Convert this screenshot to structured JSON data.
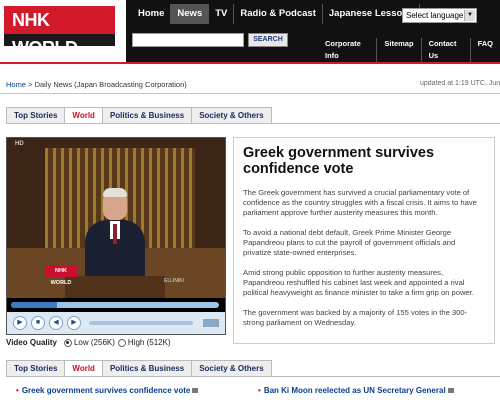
{
  "header": {
    "logo": "NHK WORLD",
    "nav_main": [
      "Home",
      "News",
      "TV",
      "Radio & Podcast",
      "Japanese Lessons"
    ],
    "nav_active": "News",
    "language_select": "Select language",
    "search_placeholder": "",
    "search_button": "SEARCH",
    "nav_sub": [
      "Corporate Info",
      "Sitemap",
      "Contact Us",
      "FAQ"
    ]
  },
  "breadcrumb": {
    "home": "Home",
    "sep": " > ",
    "current": "Daily News (Japan Broadcasting Corporation)"
  },
  "updated": "updated at 1:19 UTC, Jun. 22",
  "tabs": [
    "Top Stories",
    "World",
    "Politics & Business",
    "Society & Others"
  ],
  "tabs_active": "World",
  "video": {
    "hd_label": "HD",
    "watermark": "NHK WORLD",
    "corner_label": "ELLINIKI",
    "progress": 0.22,
    "quality_label": "Video Quality",
    "quality_low": "Low (256K)",
    "quality_high": "High (512K)",
    "quality_selected": "low"
  },
  "article": {
    "headline": "Greek government survives confidence vote",
    "paragraphs": [
      "The Greek government has survived a crucial parliamentary vote of confidence as the country struggles with a fiscal crisis. It aims to have parliament approve further austerity measures this month.",
      "To avoid a national debt default, Greek Prime Minister George Papandreou plans to cut the payroll of government officials and privatize state-owned enterprises.",
      "Amid strong public opposition to further austerity measures, Papandreou reshuffled his cabinet last week and appointed a rival political heavyweight as finance minister to take a firm grip on power.",
      "The government was backed by a majority of 155 votes in the 300-strong parliament on Wednesday."
    ]
  },
  "news_list": [
    "Greek government survives confidence vote",
    "Ban Ki Moon reelected as UN Secretary General"
  ]
}
